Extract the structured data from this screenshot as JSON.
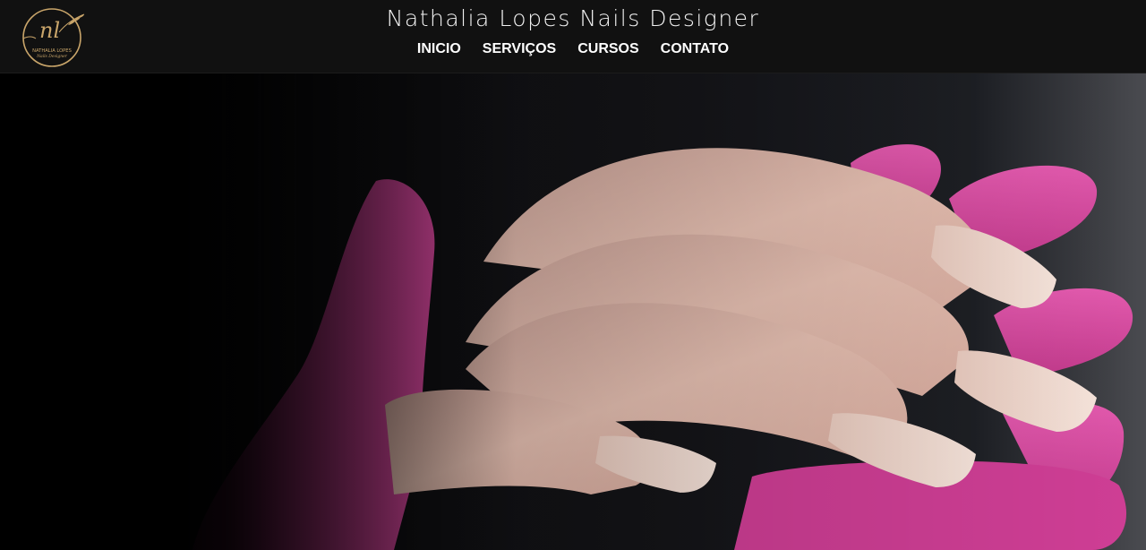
{
  "header": {
    "site_title": "Nathalia Lopes Nails Designer",
    "logo": {
      "monogram": "nl",
      "name": "NATHALIA LOPES",
      "tagline": "Nails Designer",
      "icon": "leaf-branch-icon"
    }
  },
  "nav": {
    "items": [
      {
        "label": "INICIO"
      },
      {
        "label": "SERVIÇOS"
      },
      {
        "label": "CURSOS"
      },
      {
        "label": "CONTATO"
      }
    ]
  },
  "hero": {
    "image": "hand-with-nails-in-pink-gloved-hands"
  },
  "colors": {
    "header_bg": "#111111",
    "gold": "#c9a56a",
    "glove_pink": "#d9409b",
    "skin": "#e3b9ab",
    "nail": "#f1d9cd"
  }
}
